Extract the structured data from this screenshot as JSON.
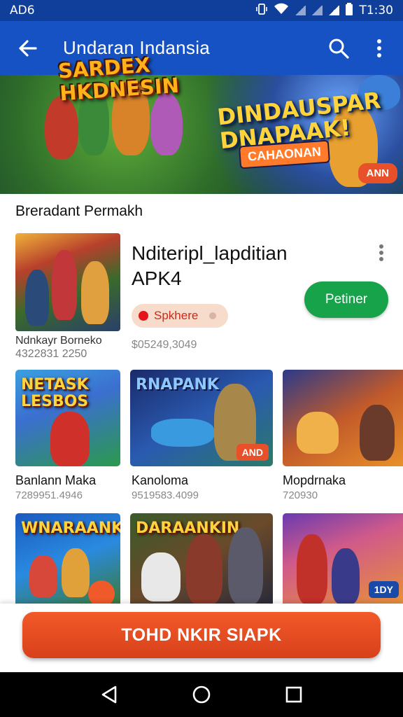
{
  "status_bar": {
    "left_text": "AD6",
    "time": "T1:30"
  },
  "app_bar": {
    "title": "Undaran Indansia"
  },
  "banner": {
    "title_left": "SARDEX HKDNESIN",
    "title_right": "DINDAUSPAR DNAPAAK!",
    "subtitle": "CAHAONAN",
    "badge": "ANN"
  },
  "section": {
    "title": "Breradant Permakh"
  },
  "featured": {
    "name": "Nditeripl_lapditian APK4",
    "install_label": "Petiner",
    "chip_label": "Spkhere",
    "price": "$05249,3049",
    "caption": "Ndnkayr Borneko",
    "caption_id": "4322831 2250"
  },
  "grid": [
    {
      "label": "Banlann Maka",
      "sub": "7289951.4946",
      "art": "NETASK LESBOS",
      "tag": ""
    },
    {
      "label": "Kanoloma",
      "sub": "9519583.4099",
      "art": "RNAPANK",
      "tag": "AND"
    },
    {
      "label": "Mopdrnaka",
      "sub": "720930",
      "art": "",
      "tag": ""
    },
    {
      "label": "",
      "sub": "",
      "art": "WNARAANK",
      "tag": ""
    },
    {
      "label": "",
      "sub": "",
      "art": "DARAANKIN",
      "tag": ""
    },
    {
      "label": "",
      "sub": "",
      "art": "",
      "tag": "1DY"
    }
  ],
  "cta": {
    "label": "TOHD NKIR SIAPK"
  },
  "colors": {
    "primary": "#1752c4",
    "status": "#0f3f9a",
    "accent_green": "#17a34a",
    "cta": "#e84a1e"
  }
}
